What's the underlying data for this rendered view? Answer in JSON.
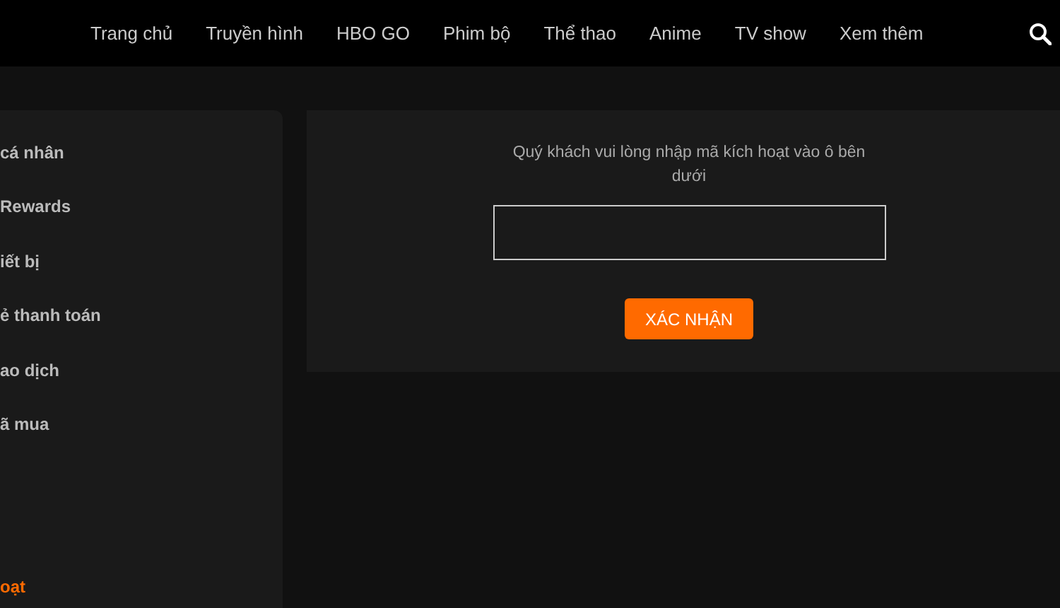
{
  "nav": {
    "items": [
      {
        "label": "Trang chủ"
      },
      {
        "label": "Truyền hình"
      },
      {
        "label": "HBO GO"
      },
      {
        "label": "Phim bộ"
      },
      {
        "label": "Thể thao"
      },
      {
        "label": "Anime"
      },
      {
        "label": "TV show"
      },
      {
        "label": "Xem thêm"
      }
    ]
  },
  "sidebar": {
    "items": [
      {
        "label": "cá nhân",
        "selected": false
      },
      {
        "label": "Rewards",
        "selected": false
      },
      {
        "label": "iết bị",
        "selected": false
      },
      {
        "label": "ẻ thanh toán",
        "selected": false
      },
      {
        "label": "ao dịch",
        "selected": false
      },
      {
        "label": "ã mua",
        "selected": false
      },
      {
        "label": "oạt",
        "selected": true
      }
    ]
  },
  "activation": {
    "instruction": "Quý khách vui lòng nhập mã kích hoạt vào ô bên dưới",
    "submit": "XÁC NHẬN"
  }
}
